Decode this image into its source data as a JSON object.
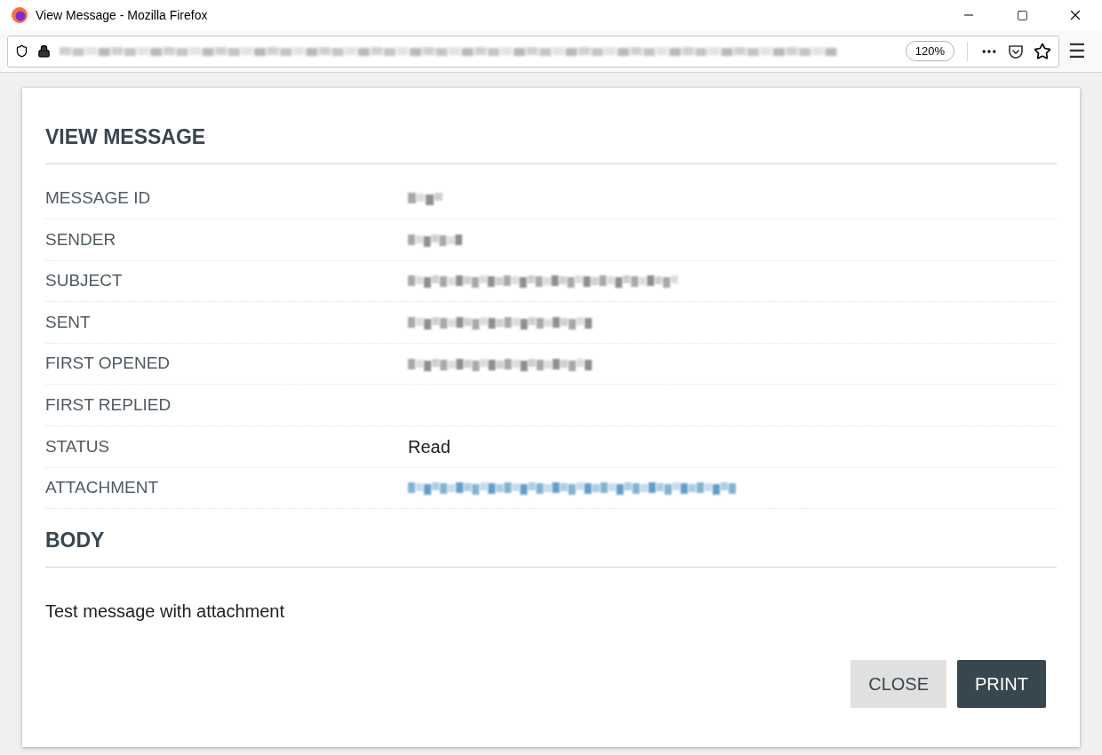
{
  "window": {
    "title": "View Message - Mozilla Firefox"
  },
  "toolbar": {
    "zoom": "120%",
    "menu_icon": "☰"
  },
  "dialog": {
    "title": "VIEW MESSAGE",
    "fields": [
      {
        "label": "MESSAGE ID",
        "kind": "redacted"
      },
      {
        "label": "SENDER",
        "kind": "redacted"
      },
      {
        "label": "SUBJECT",
        "kind": "redacted"
      },
      {
        "label": "SENT",
        "kind": "redacted"
      },
      {
        "label": "FIRST OPENED",
        "kind": "redacted"
      },
      {
        "label": "FIRST REPLIED",
        "kind": "empty"
      },
      {
        "label": "STATUS",
        "kind": "text",
        "value": "Read"
      },
      {
        "label": "ATTACHMENT",
        "kind": "redacted_link"
      }
    ],
    "body_title": "BODY",
    "body": "Test message with attachment",
    "buttons": [
      {
        "label": "CLOSE",
        "kind": "secondary"
      },
      {
        "label": "PRINT",
        "kind": "primary"
      }
    ]
  }
}
